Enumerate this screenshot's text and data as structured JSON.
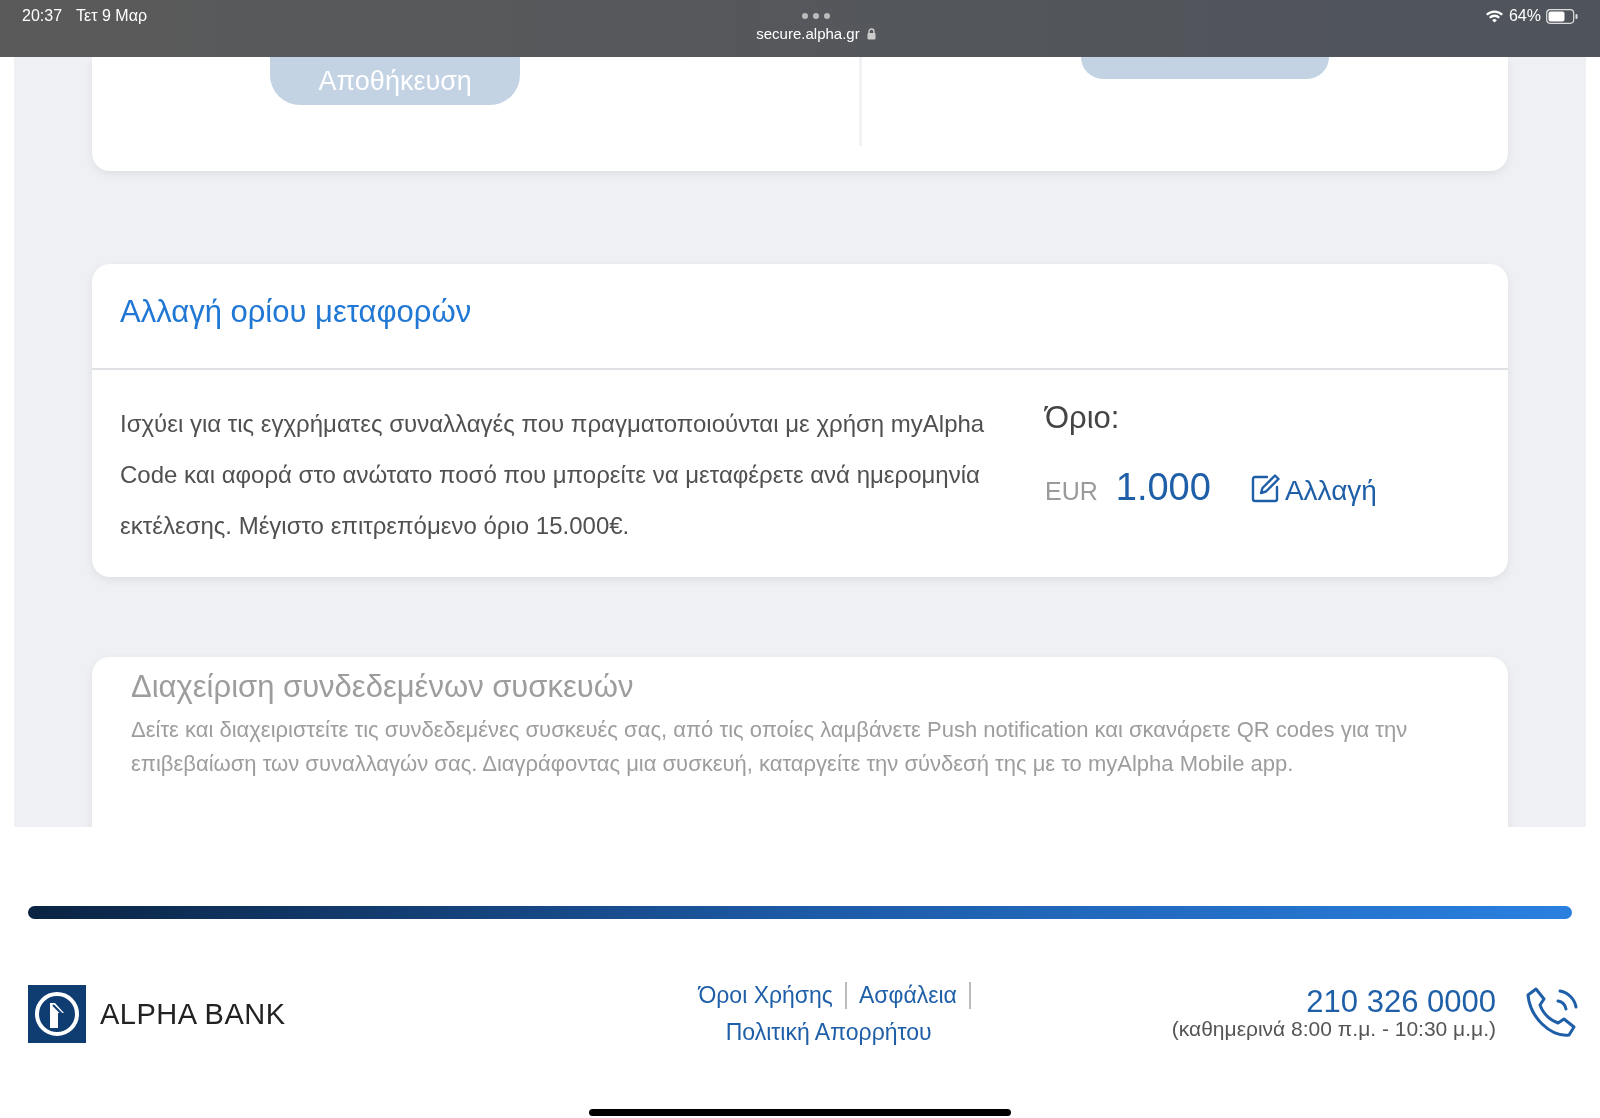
{
  "status_bar": {
    "time": "20:37",
    "date": "Τετ 9 Μαρ",
    "url": "secure.alpha.gr",
    "battery": "64%"
  },
  "top_card": {
    "buttons": [
      {
        "label": "Αποθήκευση",
        "disabled": true
      },
      {
        "disabled": true
      }
    ]
  },
  "limit_card": {
    "title": "Αλλαγή ορίου μεταφορών",
    "description": "Ισχύει για τις εγχρήματες συναλλαγές που πραγματοποιούνται με χρήση myAlpha Code και αφορά στο ανώτατο ποσό που μπορείτε να μεταφέρετε ανά ημερομηνία εκτέλεσης. Μέγιστο επιτρεπόμενο όριο 15.000€.",
    "limit_label": "Όριο:",
    "currency": "EUR",
    "amount": "1.000",
    "change_link": "Αλλαγή"
  },
  "devices_card": {
    "title": "Διαχείριση συνδεδεμένων συσκευών",
    "description": "Δείτε και διαχειριστείτε τις συνδεδεμένες συσκευές σας, από τις οποίες λαμβάνετε Push notification και σκανάρετε QR codes για την επιβεβαίωση των συναλλαγών σας. Διαγράφοντας μια συσκευή, καταργείτε την σύνδεσή της με το myAlpha Mobile app.",
    "disabled": true
  },
  "footer": {
    "logo_text": "ALPHA BANK",
    "links": [
      "Όροι Χρήσης",
      "Ασφάλεια",
      "Πολιτική Απορρήτου"
    ],
    "phone": "210 326 0000",
    "hours": "(καθημερινά 8:00 π.μ. - 10:30 μ.μ.)"
  }
}
